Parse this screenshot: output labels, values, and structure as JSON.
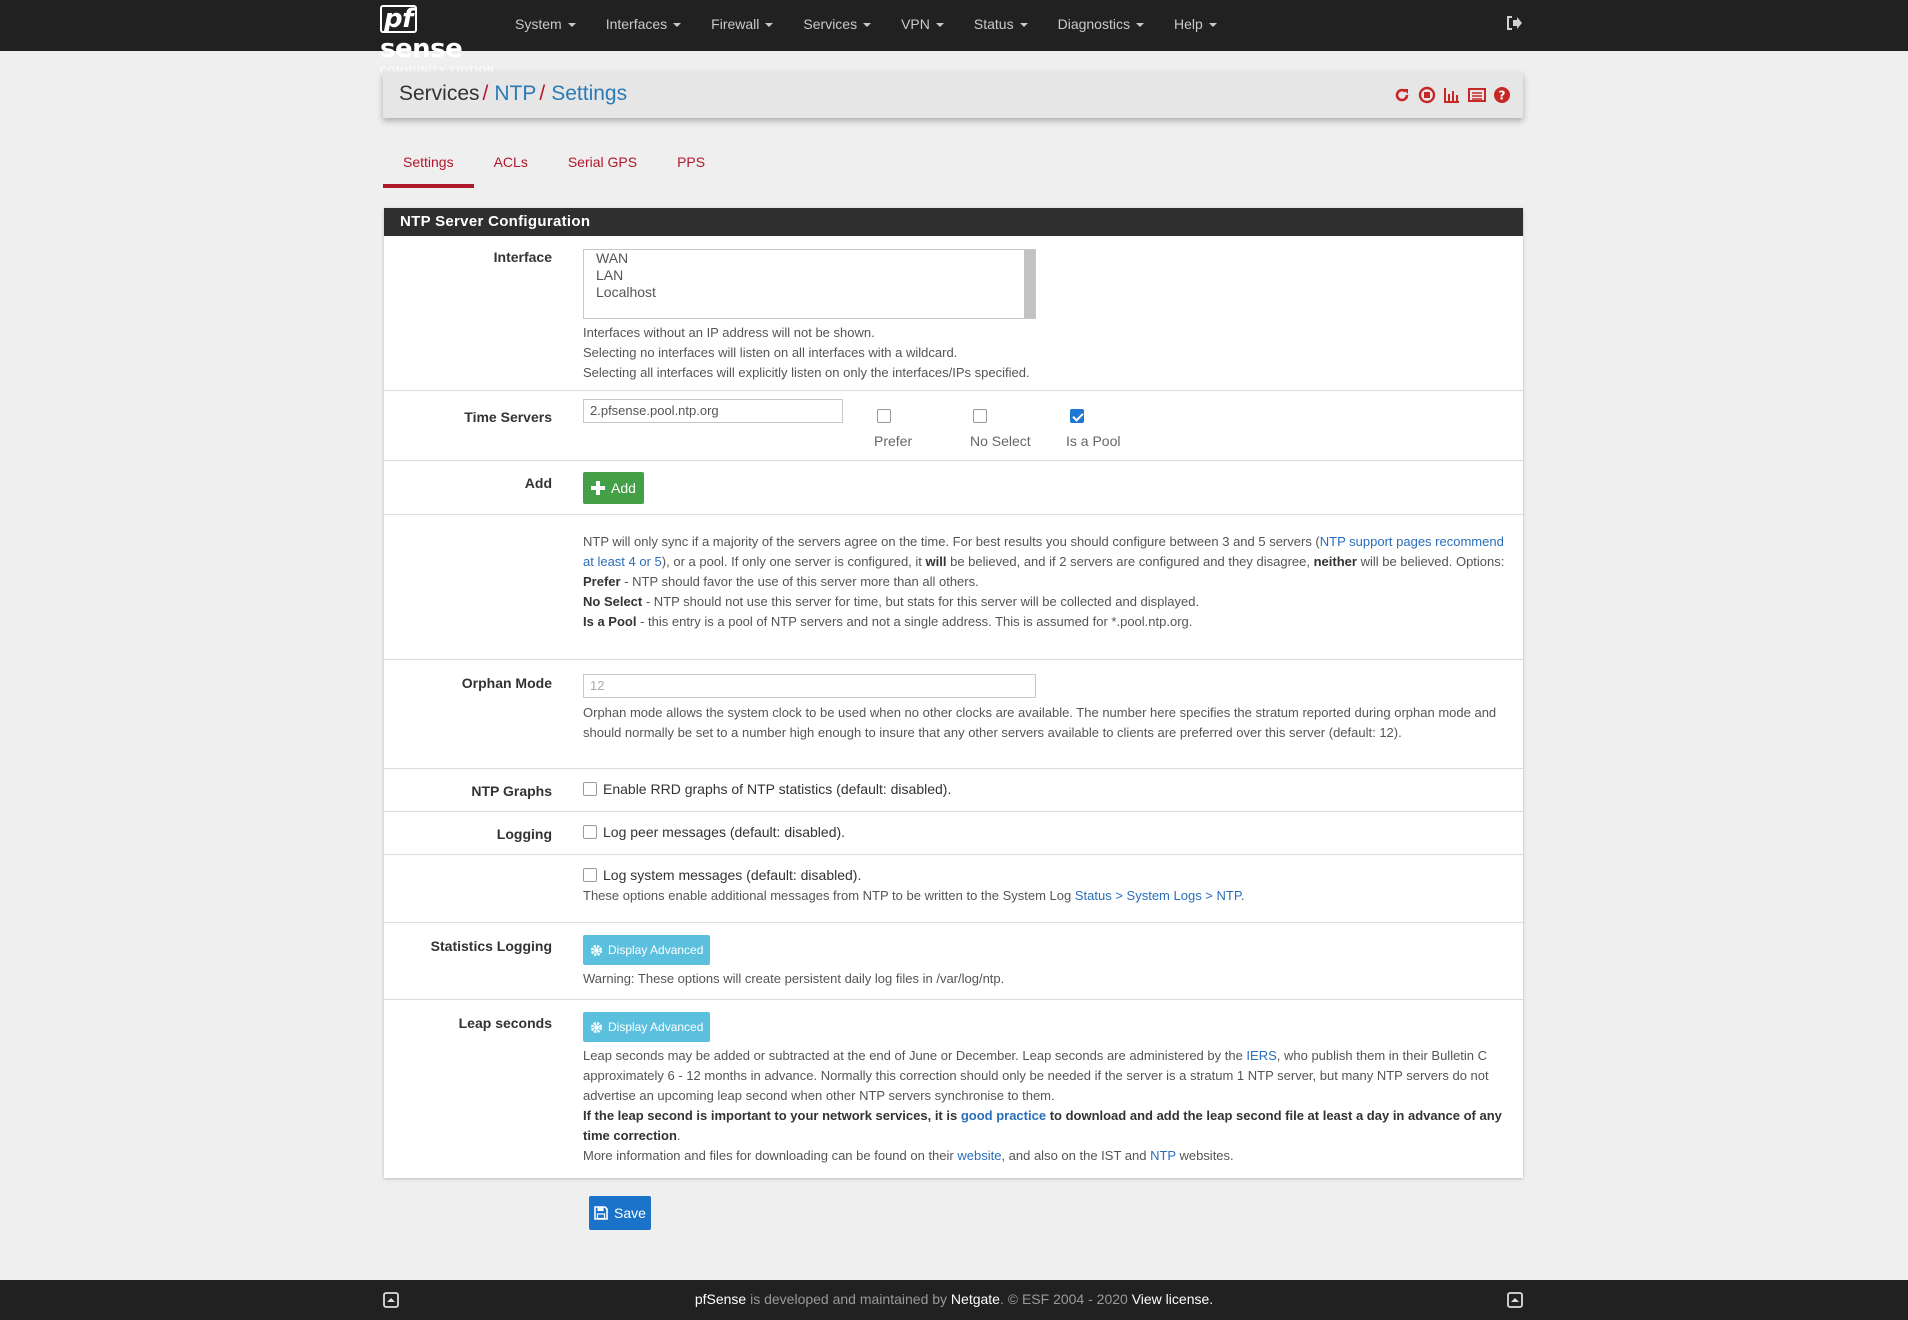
{
  "brand": {
    "pf": "pf",
    "sense": "sense",
    "edition": "COMMUNITY EDITION"
  },
  "nav": [
    "System",
    "Interfaces",
    "Firewall",
    "Services",
    "VPN",
    "Status",
    "Diagnostics",
    "Help"
  ],
  "breadcrumb": {
    "root": "Services",
    "sep1": "/",
    "level1": "NTP",
    "sep2": "/",
    "level2": "Settings"
  },
  "tabs": [
    "Settings",
    "ACLs",
    "Serial GPS",
    "PPS"
  ],
  "panel": {
    "title": "NTP Server Configuration"
  },
  "interface": {
    "label": "Interface",
    "options": [
      "WAN",
      "LAN",
      "Localhost"
    ],
    "help": [
      "Interfaces without an IP address will not be shown.",
      "Selecting no interfaces will listen on all interfaces with a wildcard.",
      "Selecting all interfaces will explicitly listen on only the interfaces/IPs specified."
    ]
  },
  "time_servers": {
    "label": "Time Servers",
    "value": "2.pfsense.pool.ntp.org",
    "prefer_label": "Prefer",
    "prefer_checked": false,
    "noselect_label": "No Select",
    "noselect_checked": false,
    "pool_label": "Is a Pool",
    "pool_checked": true
  },
  "add": {
    "label": "Add",
    "button": "Add"
  },
  "ntp_help": {
    "p1": "NTP will only sync if a majority of the servers agree on the time. For best results you should configure between 3 and 5 servers (",
    "p1_link": "NTP support pages recommend at least 4 or 5",
    "p1b": "), or a pool. If only one server is configured, it ",
    "p1_will": "will",
    "p1c": " be believed, and if 2 servers are configured and they disagree, ",
    "p1_neither": "neither",
    "p1d": " will be believed. Options:",
    "prefer_term": "Prefer",
    "prefer_desc": " - NTP should favor the use of this server more than all others.",
    "noselect_term": "No Select",
    "noselect_desc": " - NTP should not use this server for time, but stats for this server will be collected and displayed.",
    "pool_term": "Is a Pool",
    "pool_desc": " - this entry is a pool of NTP servers and not a single address. This is assumed for *.pool.ntp.org."
  },
  "orphan": {
    "label": "Orphan Mode",
    "placeholder": "12",
    "help": "Orphan mode allows the system clock to be used when no other clocks are available. The number here specifies the stratum reported during orphan mode and should normally be set to a number high enough to insure that any other servers available to clients are preferred over this server (default: 12)."
  },
  "graphs": {
    "label": "NTP Graphs",
    "text": "Enable RRD graphs of NTP statistics (default: disabled).",
    "checked": false
  },
  "logging": {
    "label": "Logging",
    "peer_text": "Log peer messages (default: disabled).",
    "peer_checked": false,
    "system_text": "Log system messages (default: disabled).",
    "system_checked": false,
    "help_pre": "These options enable additional messages from NTP to be written to the System Log ",
    "help_link": "Status > System Logs > NTP",
    "help_post": "."
  },
  "stats": {
    "label": "Statistics Logging",
    "button": "Display Advanced",
    "help": "Warning: These options will create persistent daily log files in /var/log/ntp."
  },
  "leap": {
    "label": "Leap seconds",
    "button": "Display Advanced",
    "t1": "Leap seconds may be added or subtracted at the end of June or December. Leap seconds are administered by the ",
    "t1_link": "IERS",
    "t1b": ", who publish them in their Bulletin C approximately 6 - 12 months in advance. Normally this correction should only be needed if the server is a stratum 1 NTP server, but many NTP servers do not advertise an upcoming leap second when other NTP servers synchronise to them.",
    "b1": "If the leap second is important to your network services, it is ",
    "b1_link": "good practice",
    "b1b": " to download and add the leap second file at least a day in advance of any time correction",
    "b1c": ".",
    "t2": "More information and files for downloading can be found on their ",
    "t2_link": "website",
    "t2b": ", and also on the IST and ",
    "t2_link2": "NTP",
    "t2c": " websites."
  },
  "save": "Save",
  "footer": {
    "brand": "pfSense",
    "t1": " is developed and maintained by ",
    "company": "Netgate",
    "t2": ". © ESF 2004 - 2020 ",
    "license": "View license."
  },
  "colors": {
    "accent_red": "#b2182b",
    "link_blue": "#2a7ab6",
    "navbar": "#212121",
    "add_green": "#43a047",
    "info": "#5bc0de",
    "primary": "#1a73c8"
  }
}
